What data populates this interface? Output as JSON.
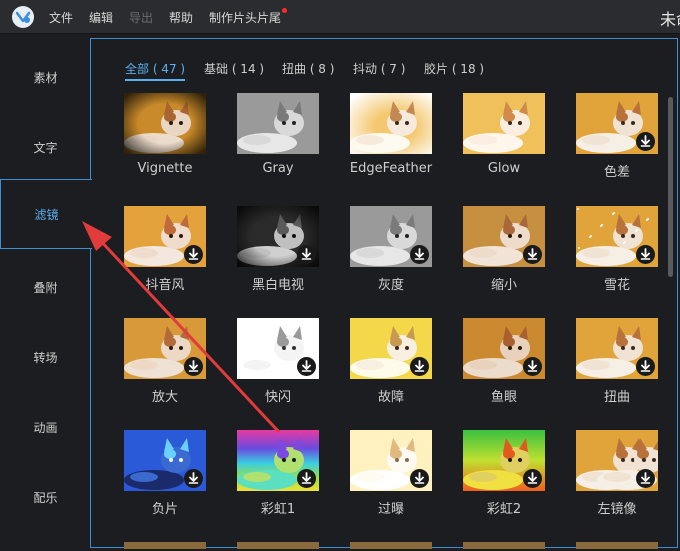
{
  "app": {
    "title": "未命名",
    "menu": [
      {
        "label": "文件",
        "disabled": false
      },
      {
        "label": "编辑",
        "disabled": false
      },
      {
        "label": "导出",
        "disabled": true
      },
      {
        "label": "帮助",
        "disabled": false
      },
      {
        "label": "制作片头片尾",
        "disabled": false,
        "has_badge": true
      }
    ]
  },
  "sidebar": {
    "items": [
      {
        "label": "素材",
        "active": false
      },
      {
        "label": "文字",
        "active": false
      },
      {
        "label": "滤镜",
        "active": true
      },
      {
        "label": "叠附",
        "active": false
      },
      {
        "label": "转场",
        "active": false
      },
      {
        "label": "动画",
        "active": false
      },
      {
        "label": "配乐",
        "active": false
      }
    ]
  },
  "tabs": [
    {
      "label": "全部 ( 47 )",
      "active": true
    },
    {
      "label": "基础 ( 14 )",
      "active": false
    },
    {
      "label": "扭曲 ( 8 )",
      "active": false
    },
    {
      "label": "抖动 ( 7 )",
      "active": false
    },
    {
      "label": "胶片 ( 18 )",
      "active": false
    }
  ],
  "filters": [
    {
      "label": "Vignette",
      "style": "vignette",
      "download": false
    },
    {
      "label": "Gray",
      "style": "gray",
      "download": false
    },
    {
      "label": "EdgeFeather",
      "style": "feather",
      "download": false
    },
    {
      "label": "Glow",
      "style": "glow",
      "download": false
    },
    {
      "label": "色差",
      "style": "chroma",
      "download": true
    },
    {
      "label": "抖音风",
      "style": "tiktok",
      "download": true
    },
    {
      "label": "黑白电视",
      "style": "bwtv",
      "download": true
    },
    {
      "label": "灰度",
      "style": "gray",
      "download": true
    },
    {
      "label": "缩小",
      "style": "shrink",
      "download": true
    },
    {
      "label": "雪花",
      "style": "snow",
      "download": true
    },
    {
      "label": "放大",
      "style": "zoom",
      "download": true
    },
    {
      "label": "快闪",
      "style": "flash",
      "download": true
    },
    {
      "label": "故障",
      "style": "glitch",
      "download": true
    },
    {
      "label": "鱼眼",
      "style": "fisheye",
      "download": true
    },
    {
      "label": "扭曲",
      "style": "normal",
      "download": true
    },
    {
      "label": "负片",
      "style": "negative",
      "download": true
    },
    {
      "label": "彩虹1",
      "style": "rainbow1",
      "download": true
    },
    {
      "label": "过曝",
      "style": "overexpose",
      "download": true
    },
    {
      "label": "彩虹2",
      "style": "rainbow2",
      "download": true
    },
    {
      "label": "左镜像",
      "style": "mirror",
      "download": true
    }
  ],
  "colors": {
    "accent": "#3f8fd0",
    "accent_text": "#5ab0f0",
    "annotation_arrow": "#e23b3b",
    "badge": "#ff2b2b"
  }
}
